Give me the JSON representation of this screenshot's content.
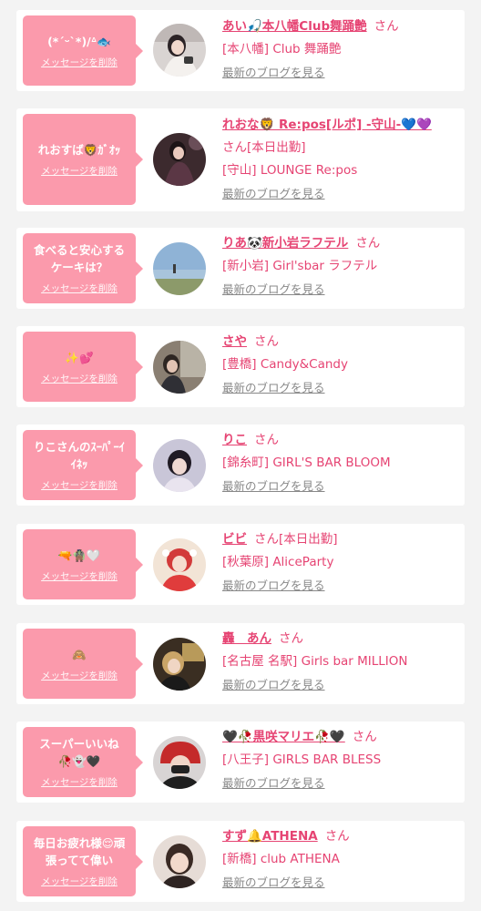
{
  "colors": {
    "accent": "#e64473",
    "bubble": "#fb9aac",
    "background": "#f3f3f3"
  },
  "labels": {
    "delete": "メッセージを削除",
    "blog": "最新のブログを見る",
    "suffix": "さん"
  },
  "items": [
    {
      "message": "(*ˊᵕˋ*)/ᐞ🐟",
      "name": "あい🎣本八幡Club舞踊艶",
      "status": "",
      "shop": "[本八幡] Club 舞踊艶"
    },
    {
      "message": "れおすば🦁ｶﾞｵｯ",
      "name": "れおな🦁 Re:pos[ルポ] -守山-💙💜",
      "status": "[本日出勤]",
      "shop": "[守山] LOUNGE Re:pos"
    },
    {
      "message": "食べると安心する\nケーキは？",
      "name": "りあ🐼新小岩ラフテル",
      "status": "",
      "shop": "[新小岩] Girl'sbar ラフテル"
    },
    {
      "message": "✨💕",
      "name": "さや",
      "status": "",
      "shop": "[豊橋] Candy&Candy"
    },
    {
      "message": "りこさんのｽｰﾊﾟｰｲ\nｲﾈｯ",
      "name": "りこ",
      "status": "",
      "shop": "[錦糸町] GIRL'S BAR BLOOM"
    },
    {
      "message": "🔫🧌🤍",
      "name": "ビビ",
      "status": "[本日出勤]",
      "shop": "[秋葉原] AliceParty"
    },
    {
      "message": "🙈",
      "name": "轟　あん",
      "status": "",
      "shop": "[名古屋 名駅] Girls bar MILLION"
    },
    {
      "message": "スーパーいいね\n🥀👻🖤",
      "name": "🖤🥀黒咲マリエ🥀🖤",
      "status": "",
      "shop": "[八王子] GIRLS BAR BLESS"
    },
    {
      "message": "毎日お疲れ様😌頑\n張ってて偉い",
      "name": "すず🔔ATHENA",
      "status": "",
      "shop": "[新橋] club ATHENA"
    }
  ]
}
